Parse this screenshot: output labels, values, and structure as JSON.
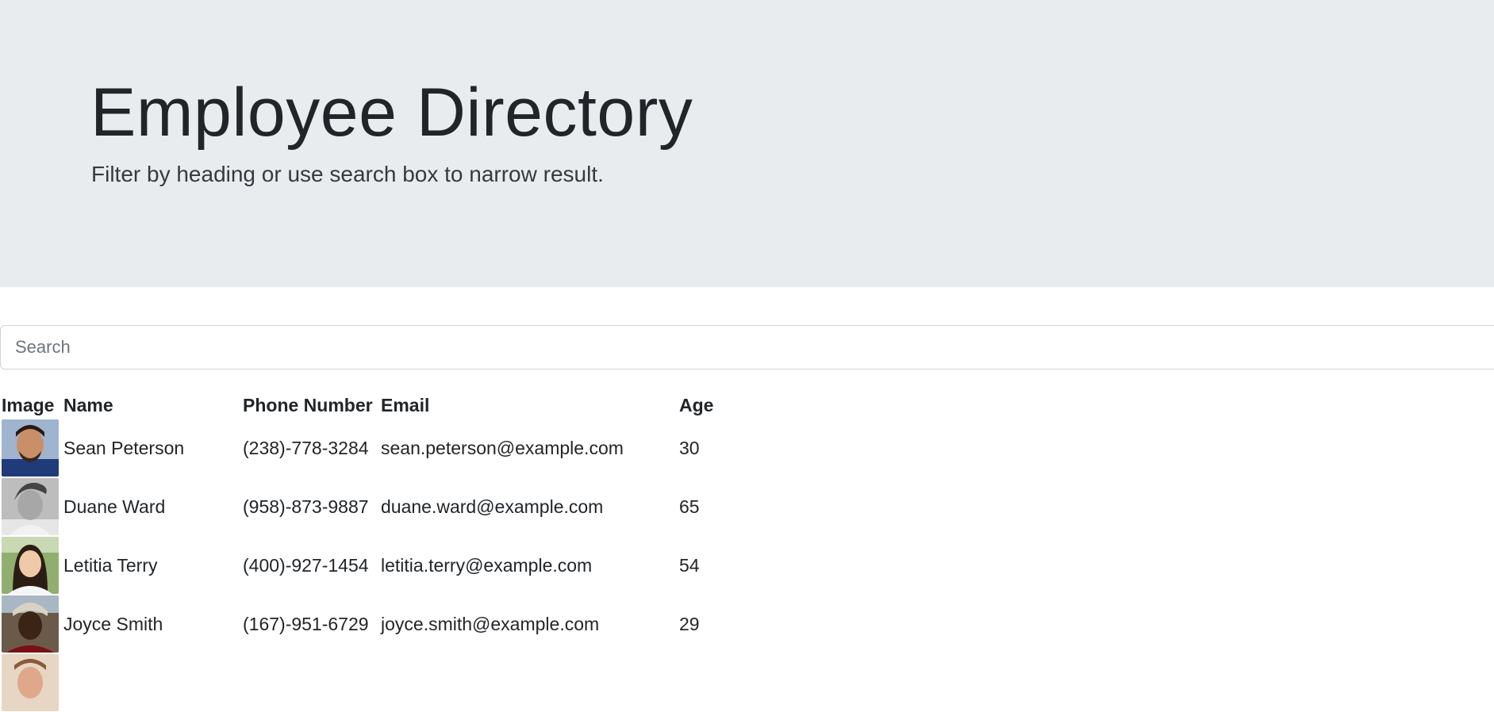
{
  "header": {
    "title": "Employee Directory",
    "subtitle": "Filter by heading or use search box to narrow result."
  },
  "search": {
    "placeholder": "Search",
    "value": ""
  },
  "table": {
    "columns": [
      "Image",
      "Name",
      "Phone Number",
      "Email",
      "Age"
    ],
    "rows": [
      {
        "name": "Sean Peterson",
        "phone": "(238)-778-3284",
        "email": "sean.peterson@example.com",
        "age": "30",
        "avatar": "person-photo"
      },
      {
        "name": "Duane Ward",
        "phone": "(958)-873-9887",
        "email": "duane.ward@example.com",
        "age": "65",
        "avatar": "person-photo"
      },
      {
        "name": "Letitia Terry",
        "phone": "(400)-927-1454",
        "email": "letitia.terry@example.com",
        "age": "54",
        "avatar": "person-photo"
      },
      {
        "name": "Joyce Smith",
        "phone": "(167)-951-6729",
        "email": "joyce.smith@example.com",
        "age": "29",
        "avatar": "person-photo"
      }
    ]
  },
  "colors": {
    "jumbotron_bg": "#e9ecef",
    "text": "#212529",
    "input_border": "#ced4da"
  }
}
